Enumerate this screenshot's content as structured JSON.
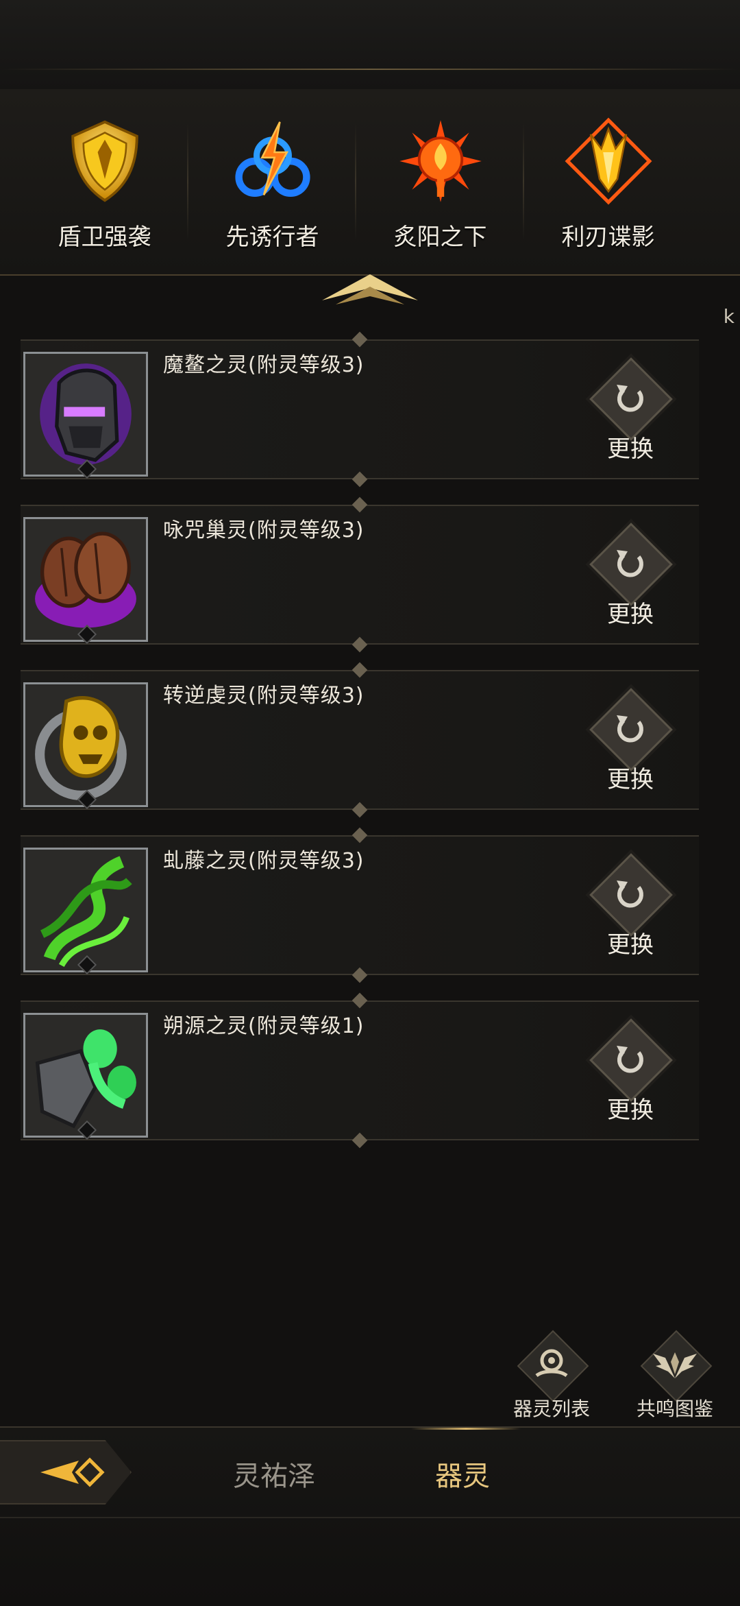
{
  "class_tabs": [
    {
      "label": "盾卫强袭",
      "icon": "shield-emblem-icon",
      "color": "#f3c21b"
    },
    {
      "label": "先诱行者",
      "icon": "lightning-swirl-emblem-icon",
      "color": "#2a8cff"
    },
    {
      "label": "炙阳之下",
      "icon": "sun-flame-emblem-icon",
      "color": "#ff5a12"
    },
    {
      "label": "利刃谍影",
      "icon": "blade-emblem-icon",
      "color": "#ffb21a"
    }
  ],
  "edge_glyph": "k",
  "spirits": [
    {
      "name": "魔鳌之灵(附灵等级3)",
      "action": "更换",
      "icon": "purple-helmet-icon"
    },
    {
      "name": "咏咒巢灵(附灵等级3)",
      "action": "更换",
      "icon": "purple-pod-icon"
    },
    {
      "name": "转逆虔灵(附灵等级3)",
      "action": "更换",
      "icon": "golden-skull-icon"
    },
    {
      "name": "虬藤之灵(附灵等级3)",
      "action": "更换",
      "icon": "green-vine-icon"
    },
    {
      "name": "朔源之灵(附灵等级1)",
      "action": "更换",
      "icon": "green-ghost-armor-icon"
    }
  ],
  "actions": {
    "spirit_list": "器灵列表",
    "resonance_codex": "共鸣图鉴"
  },
  "bottom_nav": {
    "tab1": "灵祐泽",
    "tab2": "器灵"
  },
  "colors": {
    "accent": "#e8c77f",
    "background": "#121110"
  }
}
